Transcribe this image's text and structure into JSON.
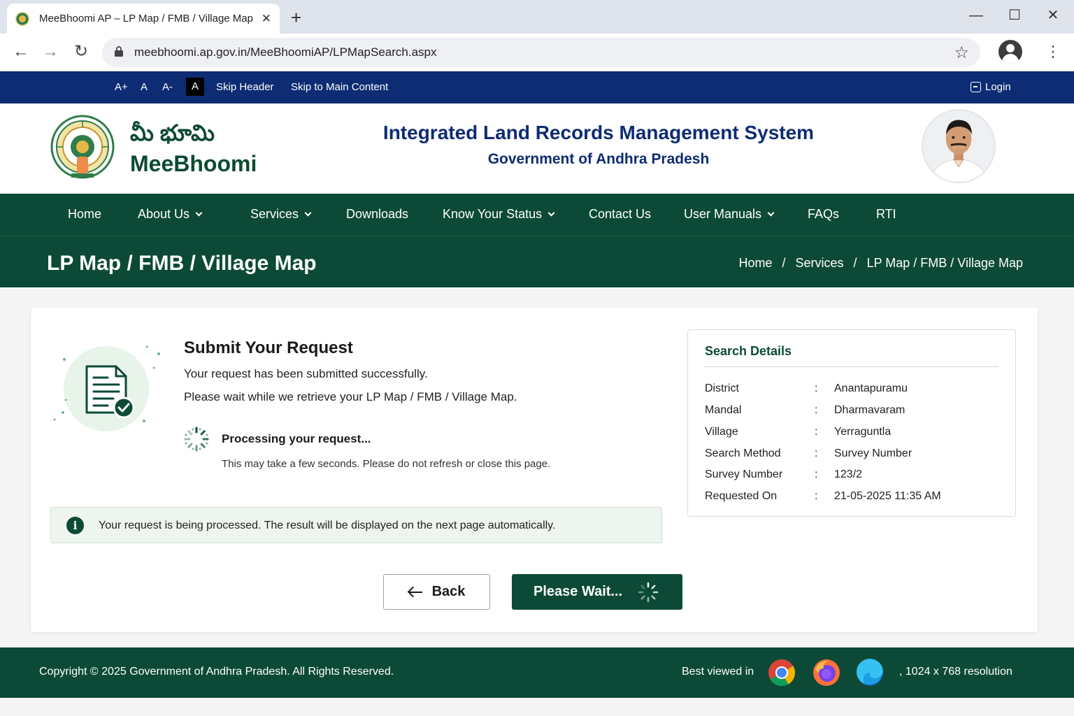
{
  "browser": {
    "tab_title": "MeeBhoomi AP – LP Map / FMB / Village Map",
    "tab_close": "✕",
    "new_tab": "+",
    "url": "meebhoomi.ap.gov.in/MeeBhoomiAP/LPMapSearch.aspx",
    "window_controls": {
      "minimize": "—",
      "maximize": "☐",
      "close": "✕"
    },
    "nav": {
      "back": "←",
      "forward": "→",
      "reload": "↻",
      "star": "☆",
      "menu": "⋮"
    }
  },
  "utility_bar": {
    "font_increase": "A+",
    "font_normal": "A",
    "font_decrease": "A-",
    "contrast": "A",
    "skip_header": "Skip Header",
    "skip_main": "Skip to Main Content",
    "login": "Login"
  },
  "header": {
    "brand_telugu": "మీ భూమి",
    "brand_english": "MeeBhoomi",
    "system_title": "Integrated Land Records Management System",
    "system_subtitle": "Government of Andhra Pradesh"
  },
  "main_nav": [
    {
      "label": "Home",
      "dropdown": false
    },
    {
      "label": "About Us",
      "dropdown": true
    },
    {
      "label": "Services",
      "dropdown": true
    },
    {
      "label": "Downloads",
      "dropdown": false
    },
    {
      "label": "Know Your Status",
      "dropdown": true
    },
    {
      "label": "Contact Us",
      "dropdown": false
    },
    {
      "label": "User Manuals",
      "dropdown": true
    },
    {
      "label": "FAQs",
      "dropdown": false
    },
    {
      "label": "RTI",
      "dropdown": false
    }
  ],
  "banner": {
    "page_title": "LP Map / FMB / Village Map",
    "breadcrumbs": [
      "Home",
      "Services",
      "LP Map / FMB / Village Map"
    ],
    "separator": "/"
  },
  "request": {
    "title": "Submit Your Request",
    "line1": "Your request has been submitted successfully.",
    "line2": "Please wait while we retrieve your LP Map / FMB / Village Map.",
    "processing": "Processing your request...",
    "processing_note": "This may take a few seconds. Please do not refresh or close this page.",
    "info_icon": "i",
    "info": "Your request is being processed. The result will be displayed on the next page automatically."
  },
  "search_details": {
    "title": "Search Details",
    "rows": [
      {
        "label": "District",
        "value": "Anantapuramu"
      },
      {
        "label": "Mandal",
        "value": "Dharmavaram"
      },
      {
        "label": "Village",
        "value": "Yerraguntla"
      },
      {
        "label": "Search Method",
        "value": "Survey Number"
      },
      {
        "label": "Survey Number",
        "value": "123/2"
      },
      {
        "label": "Requested On",
        "value": "21-05-2025 11:35 AM"
      }
    ]
  },
  "buttons": {
    "back": "Back",
    "wait": "Please Wait..."
  },
  "footer": {
    "copyright": "Copyright © 2025 Government of Andhra Pradesh. All Rights Reserved.",
    "best_viewed": "Best viewed in",
    "resolution": ", 1024 x 768 resolution"
  },
  "colors": {
    "primary_green": "#0c4a37",
    "utility_blue": "#0e2c73",
    "success_check": "#0c4a37",
    "info_bg": "#eef5ef"
  },
  "icons": [
    "favicon-icon",
    "lock-icon",
    "star-icon",
    "profile-icon",
    "login-icon",
    "chevron-down-icon",
    "document-check-icon",
    "spinner-icon",
    "info-icon",
    "arrow-left-icon",
    "chrome-icon",
    "firefox-icon",
    "edge-icon"
  ]
}
